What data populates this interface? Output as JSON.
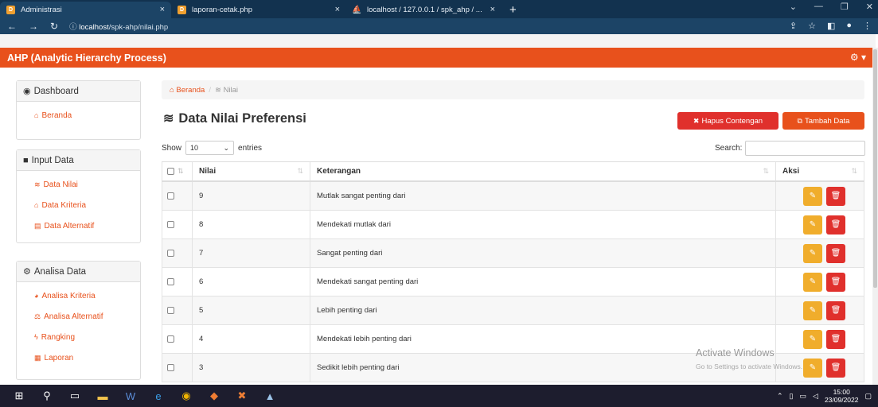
{
  "browser": {
    "tabs": [
      {
        "title": "Administrasi",
        "close": "×"
      },
      {
        "title": "laporan-cetak.php",
        "close": "×"
      },
      {
        "title": "localhost / 127.0.0.1 / spk_ahp / ...",
        "close": "×"
      }
    ],
    "new_tab": "+",
    "url_host": "localhost",
    "url_path": "/spk-ahp/nilai.php"
  },
  "app": {
    "title": "AHP (Analytic Hierarchy Process)",
    "settings_icon": "gear-icon"
  },
  "sidebar": {
    "dashboard": {
      "heading": "Dashboard",
      "items": [
        "Beranda"
      ]
    },
    "input": {
      "heading": "Input Data",
      "items": [
        "Data Nilai",
        "Data Kriteria",
        "Data Alternatif"
      ]
    },
    "analisa": {
      "heading": "Analisa Data",
      "items": [
        "Analisa Kriteria",
        "Analisa Alternatif",
        "Rangking",
        "Laporan"
      ]
    }
  },
  "breadcrumb": {
    "home": "Beranda",
    "separator": "/",
    "current": "Nilai"
  },
  "page": {
    "title": "Data Nilai Preferensi",
    "btn_clear": "Hapus Contengan",
    "btn_add": "Tambah Data"
  },
  "table_controls": {
    "show_label": "Show",
    "entries_value": "10",
    "entries_label": "entries",
    "search_label": "Search:",
    "search_value": ""
  },
  "table": {
    "headers": [
      "Nilai",
      "Keterangan",
      "Aksi"
    ],
    "rows": [
      {
        "nilai": "9",
        "keterangan": "Mutlak sangat penting dari"
      },
      {
        "nilai": "8",
        "keterangan": "Mendekati mutlak dari"
      },
      {
        "nilai": "7",
        "keterangan": "Sangat penting dari"
      },
      {
        "nilai": "6",
        "keterangan": "Mendekati sangat penting dari"
      },
      {
        "nilai": "5",
        "keterangan": "Lebih penting dari"
      },
      {
        "nilai": "4",
        "keterangan": "Mendekati lebih penting dari"
      },
      {
        "nilai": "3",
        "keterangan": "Sedikit lebih penting dari"
      }
    ]
  },
  "watermark": {
    "title": "Activate Windows",
    "subtitle": "Go to Settings to activate Windows."
  },
  "taskbar": {
    "time": "15:00",
    "date": "23/09/2022"
  },
  "colors": {
    "accent": "#e8511c",
    "danger": "#e0302c",
    "warning": "#f0ad2c",
    "browser_dark": "#12324f"
  }
}
